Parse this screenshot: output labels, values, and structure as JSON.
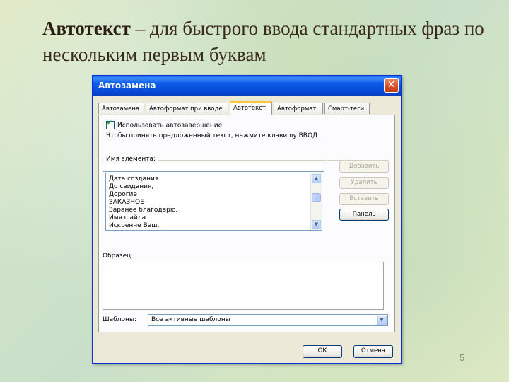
{
  "slide": {
    "title_bold": "Автотекст",
    "title_rest": " – для быстрого ввода стандартных фраз по нескольким первым буквам",
    "page_number": "5"
  },
  "dialog": {
    "title": "Автозамена",
    "tabs": [
      "Автозамена",
      "Автоформат при вводе",
      "Автотекст",
      "Автоформат",
      "Смарт-теги"
    ],
    "active_tab": "Автотекст",
    "checkbox_label": "Использовать автозавершение",
    "hint": "Чтобы принять предложенный текст, нажмите клавишу ВВОД",
    "name_label": "Имя элемента:",
    "name_value": "",
    "list_items": [
      "Дата создания",
      "До свидания,",
      "Дорогие",
      "ЗАКАЗНОЕ",
      "Заранее благодарю,",
      "Имя файла",
      "Искренне Ваш,"
    ],
    "buttons": {
      "add": "Добавить",
      "delete": "Удалить",
      "insert": "Вставить",
      "panel": "Панель"
    },
    "sample_label": "Образец",
    "templates_label": "Шаблоны:",
    "templates_value": "Все активные шаблоны",
    "ok": "ОК",
    "cancel": "Отмена"
  },
  "colors": {
    "titlebar": "#0b5ce8",
    "dialog_bg": "#ece9d8",
    "close": "#d9502a"
  }
}
